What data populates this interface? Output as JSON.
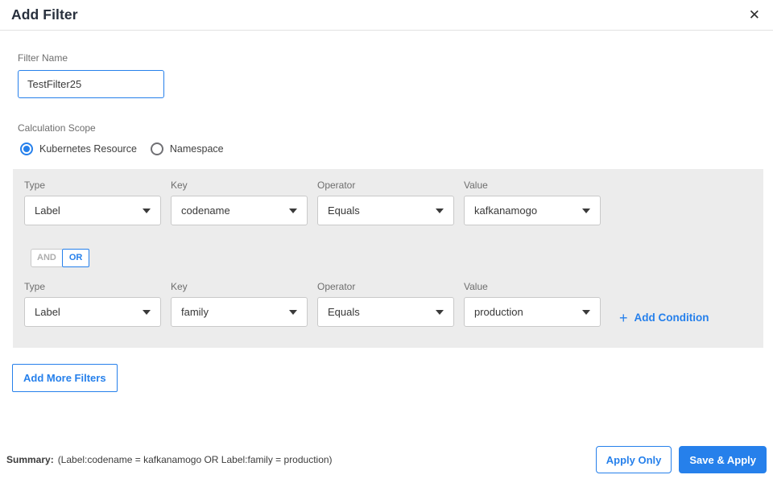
{
  "modal": {
    "title": "Add Filter",
    "close_glyph": "✕"
  },
  "filter_name": {
    "label": "Filter Name",
    "value": "TestFilter25"
  },
  "calculation_scope": {
    "label": "Calculation Scope",
    "options": [
      {
        "label": "Kubernetes Resource",
        "selected": true
      },
      {
        "label": "Namespace",
        "selected": false
      }
    ]
  },
  "conditions": {
    "rows": [
      {
        "type_label": "Type",
        "type": "Label",
        "key_label": "Key",
        "key": "codename",
        "operator_label": "Operator",
        "operator": "Equals",
        "value_label": "Value",
        "value": "kafkanamogo"
      },
      {
        "type_label": "Type",
        "type": "Label",
        "key_label": "Key",
        "key": "family",
        "operator_label": "Operator",
        "operator": "Equals",
        "value_label": "Value",
        "value": "production"
      }
    ],
    "logic": {
      "and_label": "AND",
      "or_label": "OR",
      "selected": "OR"
    },
    "add_condition": {
      "plus_glyph": "+",
      "label": "Add Condition"
    }
  },
  "add_more_filters_label": "Add More Filters",
  "footer": {
    "summary_label": "Summary:",
    "summary_text": "(Label:codename = kafkanamogo OR Label:family = production)",
    "apply_only_label": "Apply Only",
    "save_apply_label": "Save & Apply"
  },
  "colors": {
    "accent": "#2680eb",
    "panel_background": "#ececec",
    "title_text": "#28303d",
    "label_gray": "#6e6e6e"
  }
}
